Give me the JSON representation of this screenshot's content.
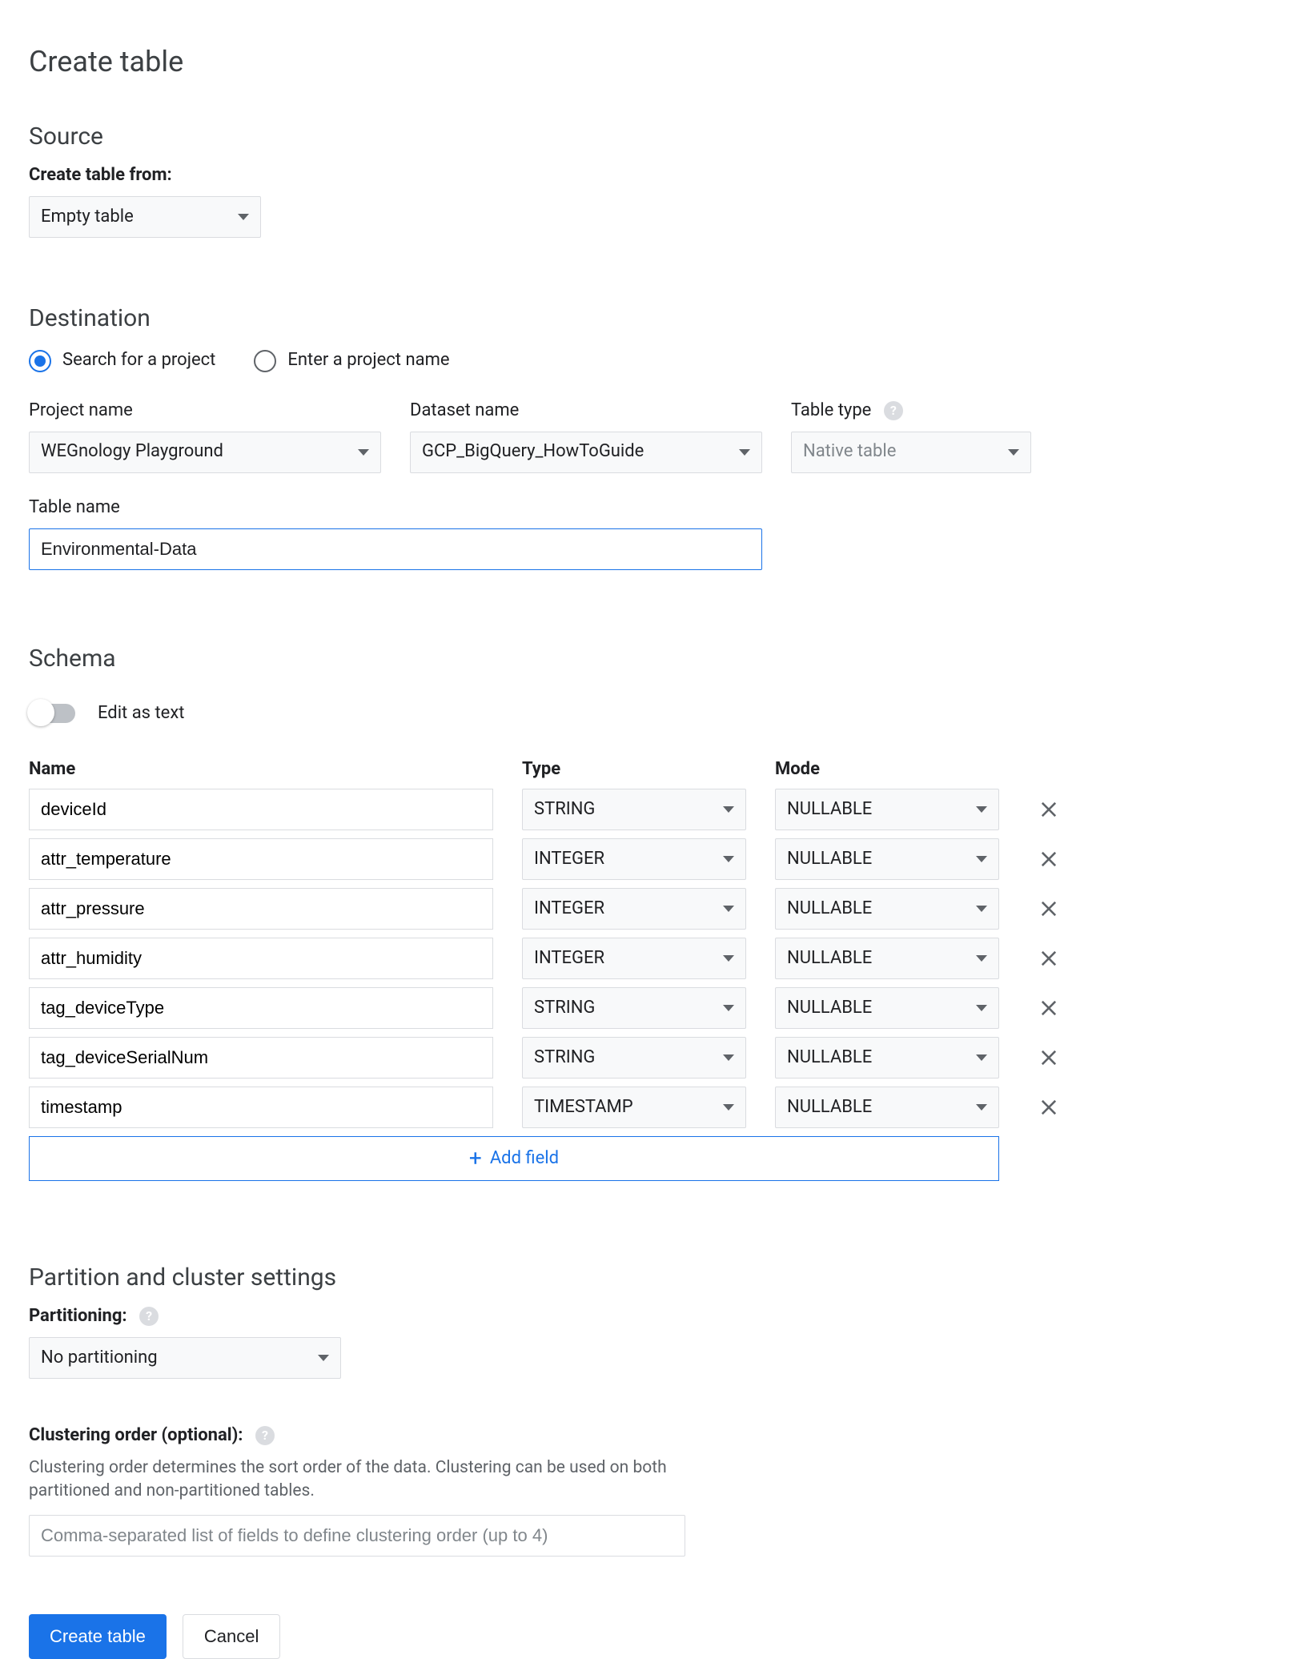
{
  "page_title": "Create table",
  "source": {
    "heading": "Source",
    "create_from_label": "Create table from:",
    "create_from_value": "Empty table"
  },
  "destination": {
    "heading": "Destination",
    "radio_search_label": "Search for a project",
    "radio_enter_label": "Enter a project name",
    "radio_selected": "search",
    "project_name_label": "Project name",
    "project_name_value": "WEGnology Playground",
    "dataset_name_label": "Dataset name",
    "dataset_name_value": "GCP_BigQuery_HowToGuide",
    "table_type_label": "Table type",
    "table_type_value": "Native table",
    "table_name_label": "Table name",
    "table_name_value": "Environmental-Data"
  },
  "schema": {
    "heading": "Schema",
    "edit_as_text_label": "Edit as text",
    "columns": {
      "name": "Name",
      "type": "Type",
      "mode": "Mode"
    },
    "fields": [
      {
        "name": "deviceId",
        "type": "STRING",
        "mode": "NULLABLE"
      },
      {
        "name": "attr_temperature",
        "type": "INTEGER",
        "mode": "NULLABLE"
      },
      {
        "name": "attr_pressure",
        "type": "INTEGER",
        "mode": "NULLABLE"
      },
      {
        "name": "attr_humidity",
        "type": "INTEGER",
        "mode": "NULLABLE"
      },
      {
        "name": "tag_deviceType",
        "type": "STRING",
        "mode": "NULLABLE"
      },
      {
        "name": "tag_deviceSerialNum",
        "type": "STRING",
        "mode": "NULLABLE"
      },
      {
        "name": "timestamp",
        "type": "TIMESTAMP",
        "mode": "NULLABLE"
      }
    ],
    "add_field_label": "Add field"
  },
  "partition": {
    "heading": "Partition and cluster settings",
    "partitioning_label": "Partitioning:",
    "partitioning_value": "No partitioning",
    "clustering_label": "Clustering order (optional):",
    "clustering_desc": "Clustering order determines the sort order of the data. Clustering can be used on both partitioned and non-partitioned tables.",
    "clustering_placeholder": "Comma-separated list of fields to define clustering order (up to 4)"
  },
  "footer": {
    "create_label": "Create table",
    "cancel_label": "Cancel"
  }
}
